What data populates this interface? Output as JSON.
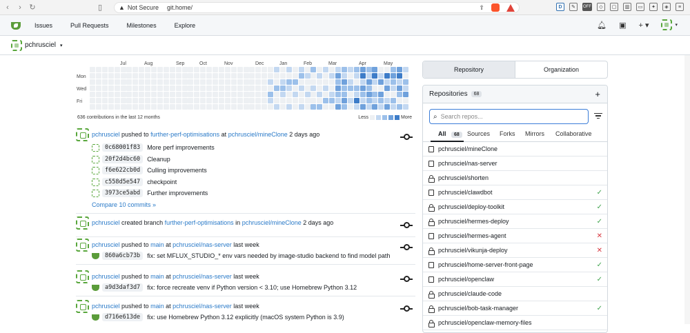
{
  "browser": {
    "back": "‹",
    "forward": "›",
    "reload": "↻",
    "security": "Not Secure",
    "url": "git.home/",
    "extensions": [
      "D",
      "OFF"
    ]
  },
  "topnav": {
    "links": [
      "Issues",
      "Pull Requests",
      "Milestones",
      "Explore"
    ],
    "plus": "+ ▾",
    "avatar_caret": "▾"
  },
  "context": {
    "user": "pchrusciel",
    "caret": "▾"
  },
  "heatmap": {
    "months": [
      "Jul",
      "Aug",
      "Sep",
      "Oct",
      "Nov",
      "Dec",
      "Jan",
      "Feb",
      "Mar",
      "Apr",
      "May"
    ],
    "days": [
      "Mon",
      "Wed",
      "Fri"
    ],
    "summary": "636 contributions in the last 12 months",
    "less": "Less",
    "more": "More",
    "colors": [
      "#edf0f3",
      "#c3d8f1",
      "#9cc0ea",
      "#6fa1dc",
      "#3d7cc8"
    ]
  },
  "feed": [
    {
      "user": "pchrusciel",
      "action": "pushed to",
      "target": "further-perf-optimisations",
      "prep": "at",
      "repo": "pchrusciel/mineClone",
      "time": "2 days ago",
      "commits": [
        {
          "sha": "0c68001f83",
          "msg": "More perf improvements"
        },
        {
          "sha": "20f2d4bc60",
          "msg": "Cleanup"
        },
        {
          "sha": "f6e622cb0d",
          "msg": "Culling improvements"
        },
        {
          "sha": "c558d5e547",
          "msg": "checkpoint"
        },
        {
          "sha": "3973ce5abd",
          "msg": "Further improvements"
        }
      ],
      "compare": "Compare 10 commits »"
    },
    {
      "user": "pchrusciel",
      "action": "created branch",
      "target": "further-perf-optimisations",
      "prep": "in",
      "repo": "pchrusciel/mineClone",
      "time": "2 days ago",
      "commits": []
    },
    {
      "user": "pchrusciel",
      "action": "pushed to",
      "target": "main",
      "prep": "at",
      "repo": "pchrusciel/nas-server",
      "time": "last week",
      "commits": [
        {
          "sha": "860a6cb73b",
          "msg": "fix: set MFLUX_STUDIO_* env vars needed by image-studio backend to find model path"
        }
      ]
    },
    {
      "user": "pchrusciel",
      "action": "pushed to",
      "target": "main",
      "prep": "at",
      "repo": "pchrusciel/nas-server",
      "time": "last week",
      "commits": [
        {
          "sha": "a9d3daf3d7",
          "msg": "fix: force recreate venv if Python version < 3.10; use Homebrew Python 3.12"
        }
      ]
    },
    {
      "user": "pchrusciel",
      "action": "pushed to",
      "target": "main",
      "prep": "at",
      "repo": "pchrusciel/nas-server",
      "time": "last week",
      "commits": [
        {
          "sha": "d716e613de",
          "msg": "fix: use Homebrew Python 3.12 explicitly (macOS system Python is 3.9)"
        }
      ]
    }
  ],
  "sidebar": {
    "tabs": [
      "Repository",
      "Organization"
    ],
    "title": "Repositories",
    "count": "68",
    "plus": "+",
    "search_placeholder": "Search repos...",
    "subtabs": {
      "all": "All",
      "all_count": "68",
      "sources": "Sources",
      "forks": "Forks",
      "mirrors": "Mirrors",
      "collaborative": "Collaborative"
    },
    "repos": [
      {
        "name": "pchrusciel/mineClone",
        "icon": "book",
        "status": ""
      },
      {
        "name": "pchrusciel/nas-server",
        "icon": "book",
        "status": ""
      },
      {
        "name": "pchrusciel/shorten",
        "icon": "lock",
        "status": ""
      },
      {
        "name": "pchrusciel/clawdbot",
        "icon": "book",
        "status": "✓"
      },
      {
        "name": "pchrusciel/deploy-toolkit",
        "icon": "lock",
        "status": "✓"
      },
      {
        "name": "pchrusciel/hermes-deploy",
        "icon": "lock",
        "status": "✓"
      },
      {
        "name": "pchrusciel/hermes-agent",
        "icon": "book",
        "status": "✕"
      },
      {
        "name": "pchrusciel/vikunja-deploy",
        "icon": "lock",
        "status": "✕"
      },
      {
        "name": "pchrusciel/home-server-front-page",
        "icon": "book",
        "status": "✓"
      },
      {
        "name": "pchrusciel/openclaw",
        "icon": "book",
        "status": "✓"
      },
      {
        "name": "pchrusciel/claude-code",
        "icon": "lock",
        "status": ""
      },
      {
        "name": "pchrusciel/bob-task-manager",
        "icon": "lock",
        "status": "✓"
      },
      {
        "name": "pchrusciel/openclaw-memory-files",
        "icon": "lock",
        "status": ""
      }
    ]
  }
}
